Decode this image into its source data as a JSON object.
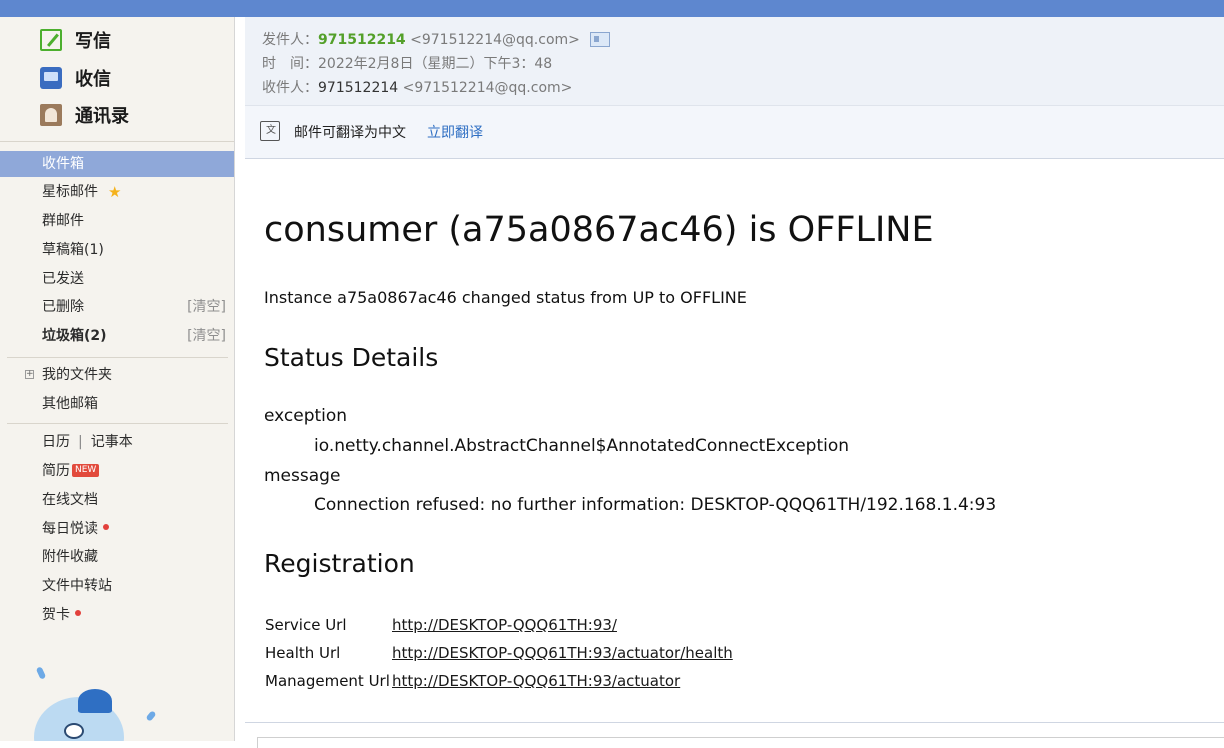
{
  "actions": {
    "write": "写信",
    "inbox": "收信",
    "contacts": "通讯录"
  },
  "folders": {
    "inbox": "收件箱",
    "starred": "星标邮件",
    "group": "群邮件",
    "drafts": "草稿箱(1)",
    "sent": "已发送",
    "deleted": "已删除",
    "spam": "垃圾箱(2)",
    "clear_label": "[清空]"
  },
  "more": {
    "my_folders": "我的文件夹",
    "other_mailboxes": "其他邮箱"
  },
  "apps": {
    "calendar": "日历",
    "separator": "|",
    "notes": "记事本",
    "resume": "简历",
    "new_badge": "NEW",
    "docs": "在线文档",
    "daily_read": "每日悦读",
    "attachments": "附件收藏",
    "file_transfer": "文件中转站",
    "cards": "贺卡"
  },
  "header": {
    "from_label": "发件人：",
    "from_name": "971512214",
    "from_email": "<971512214@qq.com>",
    "time_label": "时　间：",
    "time_value": "2022年2月8日（星期二）下午3：48",
    "to_label": "收件人：",
    "to_name": "971512214",
    "to_email": "<971512214@qq.com>"
  },
  "translate": {
    "text": "邮件可翻译为中文",
    "link": "立即翻译"
  },
  "body": {
    "subject": "consumer (a75a0867ac46) is OFFLINE",
    "intro": "Instance a75a0867ac46 changed status from UP to OFFLINE",
    "status_heading": "Status Details",
    "exception_label": "exception",
    "exception_value": "io.netty.channel.AbstractChannel$AnnotatedConnectException",
    "message_label": "message",
    "message_value": "Connection refused: no further information: DESKTOP-QQQ61TH/192.168.1.4:93",
    "registration_heading": "Registration",
    "registration": [
      {
        "key": "Service Url",
        "value": "http://DESKTOP-QQQ61TH:93/"
      },
      {
        "key": "Health Url",
        "value": "http://DESKTOP-QQQ61TH:93/actuator/health"
      },
      {
        "key": "Management Url",
        "value": "http://DESKTOP-QQQ61TH:93/actuator"
      }
    ]
  },
  "colors": {
    "topbar": "#5e87cf",
    "active_folder": "#8fa8d9",
    "sender": "#54a02a",
    "link": "#2f6fc3"
  },
  "icons": [
    "write-icon",
    "inbox-icon",
    "contacts-icon",
    "star-icon",
    "contact-card-icon",
    "translate-icon",
    "expand-icon"
  ]
}
